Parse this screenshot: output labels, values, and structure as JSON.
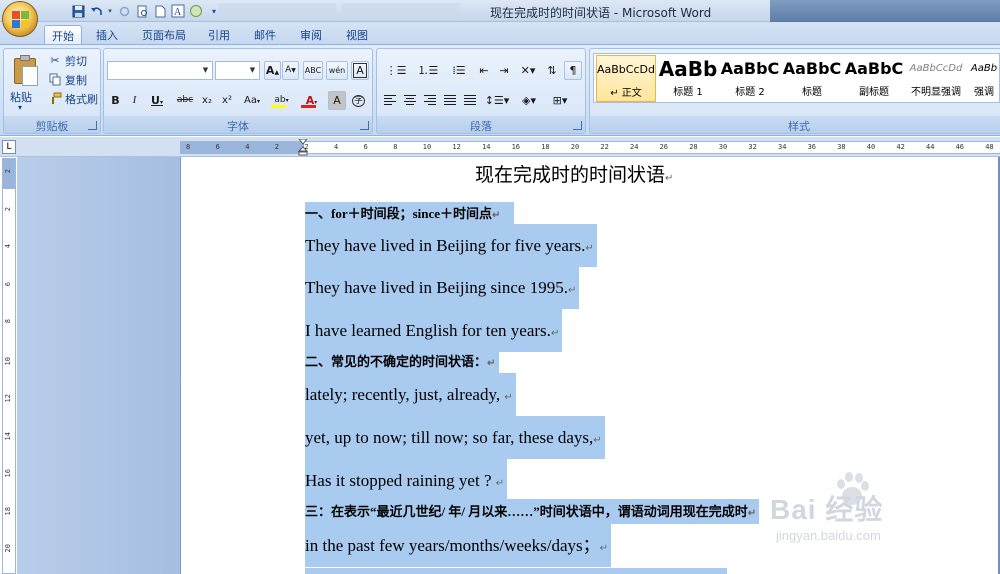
{
  "window": {
    "title": "现在完成时的时间状语 - Microsoft Word"
  },
  "quick_access": {
    "icons": [
      "save-icon",
      "undo-icon",
      "redo-icon",
      "print-preview-icon",
      "new-document-icon",
      "spelling-icon",
      "circle-icon",
      "customize-icon"
    ]
  },
  "ribbon_tabs": [
    {
      "label": "开始",
      "active": true
    },
    {
      "label": "插入",
      "active": false
    },
    {
      "label": "页面布局",
      "active": false
    },
    {
      "label": "引用",
      "active": false
    },
    {
      "label": "邮件",
      "active": false
    },
    {
      "label": "审阅",
      "active": false
    },
    {
      "label": "视图",
      "active": false
    }
  ],
  "clipboard": {
    "paste_label": "粘贴",
    "cut_label": "剪切",
    "copy_label": "复制",
    "format_painter_label": "格式刷",
    "group_label": "剪贴板"
  },
  "font": {
    "font_name_value": "",
    "font_size_value": "",
    "grow_font": "A",
    "shrink_font": "A",
    "change_case_label": "Aa",
    "clear_format_label": "ABC",
    "pinyin_label": "wén",
    "border_char_label": "A",
    "bold": "B",
    "italic": "I",
    "underline": "U",
    "strikethrough": "abc",
    "subscript": "x₂",
    "superscript": "x²",
    "highlight": "ab",
    "font_color": "A",
    "char_shading": "A",
    "enclose_char": "字",
    "group_label": "字体",
    "highlight_color": "#ffff00",
    "font_color_value": "#e02020"
  },
  "paragraph": {
    "group_label": "段落"
  },
  "styles": {
    "group_label": "样式",
    "items": [
      {
        "sample": "AaBbCcDd",
        "name": "↵ 正文",
        "selected": true
      },
      {
        "sample": "AaBb",
        "name": "标题 1",
        "selected": false
      },
      {
        "sample": "AaBbC",
        "name": "标题 2",
        "selected": false
      },
      {
        "sample": "AaBbC",
        "name": "标题",
        "selected": false
      },
      {
        "sample": "AaBbC",
        "name": "副标题",
        "selected": false
      },
      {
        "sample": "AaBbCcDd",
        "name": "不明显强调",
        "selected": false
      },
      {
        "sample": "AaBb",
        "name": "强调",
        "selected": false
      }
    ]
  },
  "ruler": {
    "tab_selector": "L",
    "h_labels": [
      "8",
      "6",
      "4",
      "2",
      "2",
      "4",
      "6",
      "8",
      "10",
      "12",
      "14",
      "16",
      "18",
      "20",
      "22",
      "24",
      "26",
      "28",
      "30",
      "32",
      "34",
      "36",
      "38",
      "40",
      "42",
      "44",
      "46",
      "48"
    ],
    "v_labels": [
      "2",
      "2",
      "4",
      "6",
      "8",
      "10",
      "12",
      "14",
      "16",
      "18",
      "20"
    ]
  },
  "document": {
    "title": "现在完成时的时间状语",
    "lines": [
      {
        "text": "一、for＋时间段；since＋时间点",
        "style": "heading"
      },
      {
        "text": " They have lived in Beijing for five years.",
        "style": "body"
      },
      {
        "text": " They have lived in Beijing since 1995.",
        "style": "body"
      },
      {
        "text": " I have learned English for ten years.",
        "style": "body"
      },
      {
        "text": "二、常见的不确定的时间状语：",
        "style": "heading"
      },
      {
        "text": "lately; recently, just, already, ",
        "style": "body"
      },
      {
        "text": "yet, up to now; till now; so far, these days,",
        "style": "body"
      },
      {
        "text": " Has it stopped raining yet ? ",
        "style": "body"
      },
      {
        "text": " 三：在表示“最近几世纪/ 年/ 月以来……”时间状语中，谓语动词用现在完成时",
        "style": "heading"
      },
      {
        "text": "in the past few years/months/weeks/days；",
        "style": "body"
      }
    ],
    "paragraph_mark": "↵",
    "selection_color": "#a9cbf0"
  },
  "watermark": {
    "brand": "Bai 经验",
    "url": "jingyan.baidu.com"
  }
}
